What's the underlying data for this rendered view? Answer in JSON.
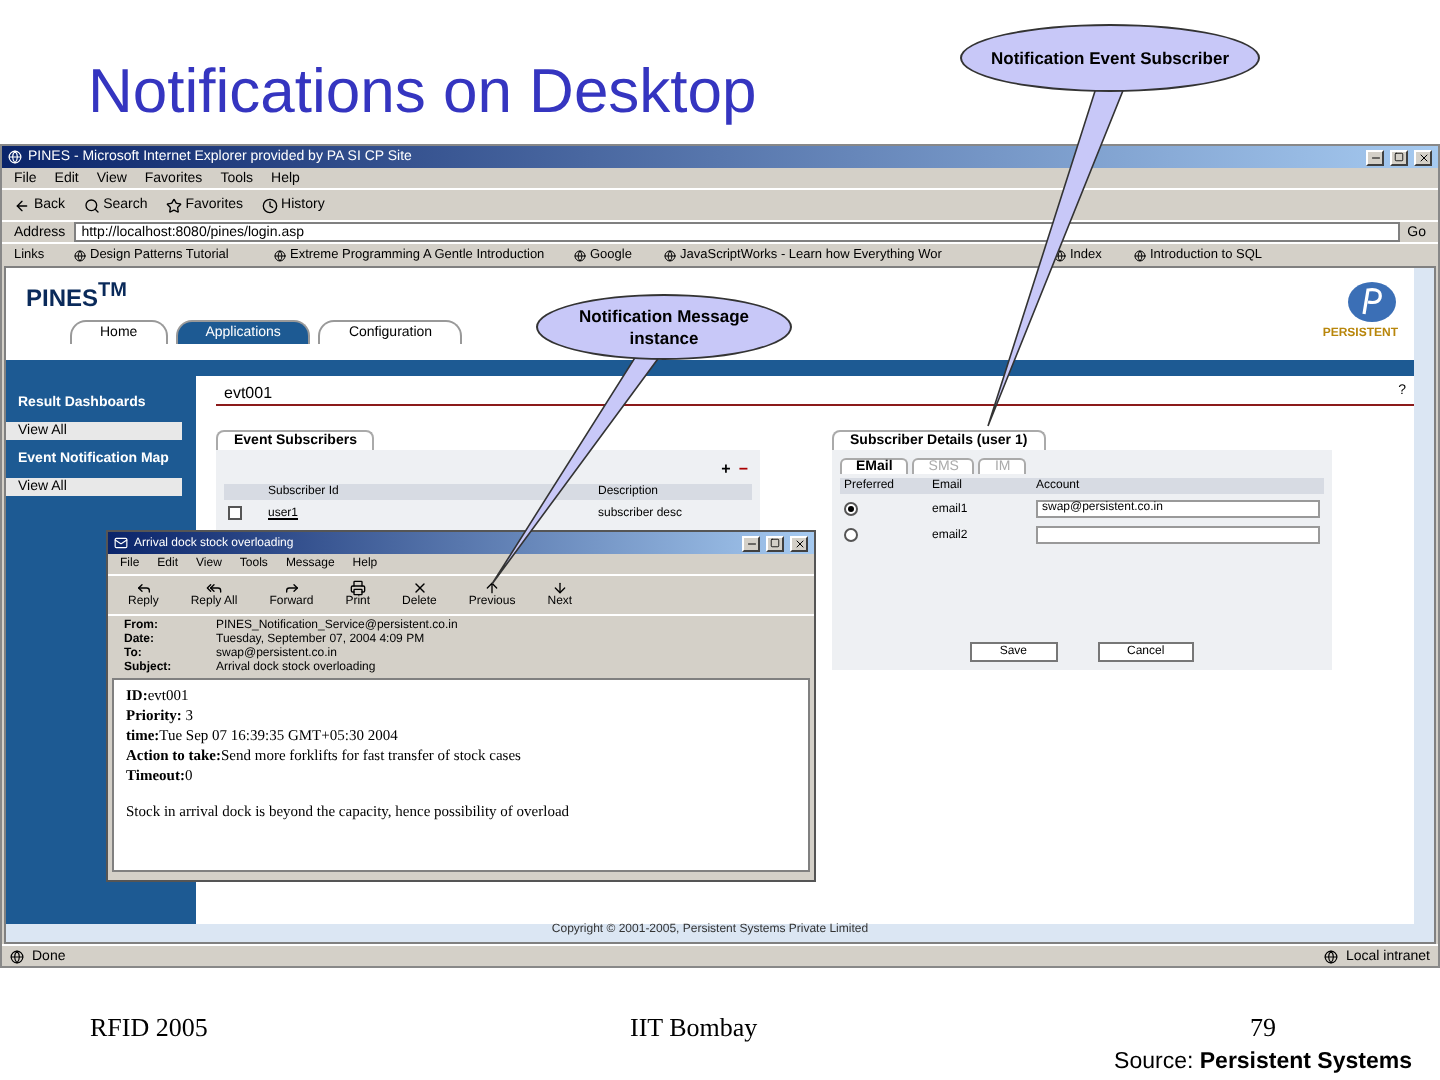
{
  "slide": {
    "title": "Notifications on Desktop",
    "footer_left": "RFID 2005",
    "footer_center": "IIT Bombay",
    "page_number": "79",
    "source_label": "Source:",
    "source_name": "Persistent Systems"
  },
  "callouts": [
    {
      "text": "Notification Event Subscriber"
    },
    {
      "text": "Notification Message instance"
    }
  ],
  "browser": {
    "title": "PINES - Microsoft Internet Explorer provided by PA SI CP Site",
    "menu": [
      "File",
      "Edit",
      "View",
      "Favorites",
      "Tools",
      "Help"
    ],
    "toolbar": [
      "Back",
      "Search",
      "Favorites",
      "History"
    ],
    "address_label": "Address",
    "address": "http://localhost:8080/pines/login.asp",
    "go": "Go",
    "links_label": "Links",
    "links": [
      "Design Patterns Tutorial",
      "Extreme Programming A Gentle Introduction",
      "Google",
      "JavaScriptWorks - Learn how Everything Wor",
      "Index",
      "Introduction to SQL"
    ],
    "status": "Done",
    "zone": "Local intranet"
  },
  "app": {
    "logo": "PINES$^{TM}$",
    "brand": "PERSISTENT",
    "tabs": [
      {
        "label": "Home",
        "selected": false
      },
      {
        "label": "Applications",
        "selected": true
      },
      {
        "label": "Configuration",
        "selected": false
      }
    ],
    "sidebar": [
      {
        "heading": "Result Dashboards",
        "items": [
          "View All"
        ]
      },
      {
        "heading": "Event Notification Map",
        "items": [
          "View All"
        ]
      }
    ],
    "content_title": "evt001",
    "help": "?",
    "subscribers": {
      "tab": "Event Subscribers",
      "add": "+",
      "remove": "−",
      "columns": [
        "Subscriber Id",
        "Description"
      ],
      "rows": [
        {
          "id": "user1",
          "description": "subscriber desc",
          "checked": false
        }
      ]
    },
    "details": {
      "title": "Subscriber Details (user 1)",
      "tabs": [
        {
          "label": "EMail",
          "selected": true
        },
        {
          "label": "SMS",
          "selected": false
        },
        {
          "label": "IM",
          "selected": false
        }
      ],
      "columns": [
        "Preferred",
        "Email",
        "Account"
      ],
      "rows": [
        {
          "selected": true,
          "label": "email1",
          "account": "swap@persistent.co.in"
        },
        {
          "selected": false,
          "label": "email2"
        }
      ],
      "buttons": [
        "Save",
        "Cancel"
      ]
    },
    "copyright": "Copyright © 2001-2005, Persistent Systems Private Limited"
  },
  "email": {
    "title": "Arrival dock stock overloading",
    "menu": [
      "File",
      "Edit",
      "View",
      "Tools",
      "Message",
      "Help"
    ],
    "toolbar": [
      "Reply",
      "Reply All",
      "Forward",
      "Print",
      "Delete",
      "Previous",
      "Next"
    ],
    "headers": [
      {
        "label": "From:",
        "value": "PINES_Notification_Service@persistent.co.in"
      },
      {
        "label": "Date:",
        "value": "Tuesday, September 07, 2004 4:09 PM"
      },
      {
        "label": "To:",
        "value": "swap@persistent.co.in"
      },
      {
        "label": "Subject:",
        "value": "Arrival dock stock overloading"
      }
    ],
    "body": [
      "**ID:**evt001",
      "**Priority:** 3",
      "**time:**Tue Sep 07 16:39:35 GMT+05:30 2004",
      "**Action to take:**Send more forklifts for fast transfer of stock cases",
      "**Timeout:**0"
    ],
    "note": "Stock in arrival dock is beyond the capacity, hence possibility of overload"
  }
}
